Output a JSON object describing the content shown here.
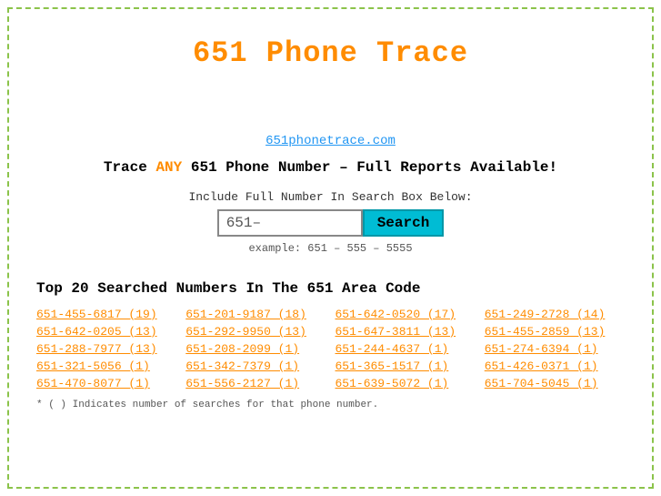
{
  "border": {
    "color": "#8bc34a"
  },
  "header": {
    "title": "651 Phone Trace",
    "site_url": "651phonetrace.com",
    "tagline_prefix": "Trace ",
    "tagline_any": "ANY",
    "tagline_suffix": " 651 Phone Number – Full Reports Available!"
  },
  "search": {
    "label": "Include Full Number In Search Box Below:",
    "input_value": "651–",
    "input_placeholder": "651-",
    "button_label": "Search",
    "example": "example: 651 – 555 – 5555"
  },
  "top_numbers_section": {
    "title": "Top 20 Searched Numbers In The 651 Area Code",
    "numbers": [
      "651-455-6817 (19)",
      "651-201-9187 (18)",
      "651-642-0520 (17)",
      "651-249-2728 (14)",
      "651-642-0205 (13)",
      "651-292-9950 (13)",
      "651-647-3811 (13)",
      "651-455-2859 (13)",
      "651-288-7977 (13)",
      "651-208-2099 (1)",
      "651-244-4637 (1)",
      "651-274-6394 (1)",
      "651-321-5056 (1)",
      "651-342-7379 (1)",
      "651-365-1517 (1)",
      "651-426-0371 (1)",
      "651-470-8077 (1)",
      "651-556-2127 (1)",
      "651-639-5072 (1)",
      "651-704-5045 (1)"
    ]
  },
  "footer": {
    "note": "* ( ) Indicates number of searches for that phone number."
  }
}
